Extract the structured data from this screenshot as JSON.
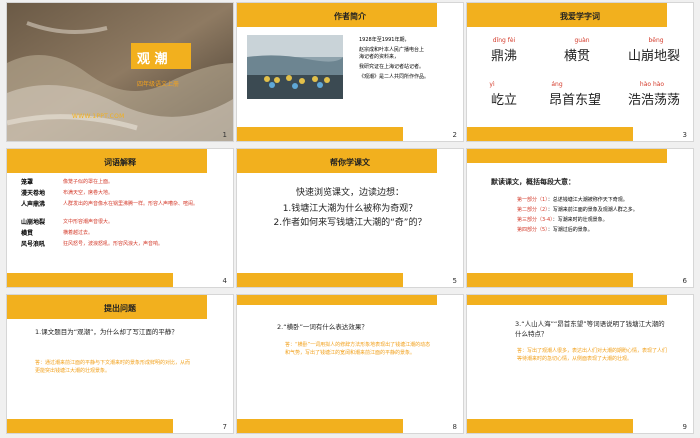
{
  "s1": {
    "title": "观 潮",
    "subtitle": "四年级语文上册",
    "website": "WWW.1PPT.COM",
    "num": "1"
  },
  "s2": {
    "title": "作者简介",
    "num": "2",
    "lines": [
      "1928年至1991年期，",
      "赵宗成和叶本人民广播电台上",
      "海记者的资料来，",
      "我研究证在上海记者站记者。",
      "《观潮》是二人共同所作作品。"
    ]
  },
  "s3": {
    "title": "我爱学字词",
    "num": "3",
    "words": [
      {
        "py": "dǐng  fèi",
        "ch": "鼎沸"
      },
      {
        "py": "guàn",
        "ch": "横贯"
      },
      {
        "py": "bēng",
        "ch": "山崩地裂"
      },
      {
        "py": "yì",
        "ch": "屹立"
      },
      {
        "py": "áng",
        "ch": "昂首东望"
      },
      {
        "py": "hào hào",
        "ch": "浩浩荡荡"
      }
    ]
  },
  "s4": {
    "title": "词语解释",
    "num": "4",
    "rows": [
      {
        "term": "笼罩",
        "def": "像笼子似的罩在上面。"
      },
      {
        "term": "漫天卷地",
        "def": "布满天空，席卷大地。"
      },
      {
        "term": "人声鼎沸",
        "def": "人群发出的声音像水在锅里沸腾一样。形容人声嘈杂、喧闹。"
      },
      {
        "term": "山崩地裂",
        "def": "文中形容潮声音很大。"
      },
      {
        "term": "横贯",
        "def": "横着越过去。"
      },
      {
        "term": "风号浪吼",
        "def": "狂风怒号，波浪怒吼。形容风浪大，声音响。"
      }
    ]
  },
  "s5": {
    "title": "帮你学课文",
    "num": "5",
    "intro": "快速浏览课文，边读边想：",
    "q1": "1.钱塘江大潮为什么被称为奇观？",
    "q2": "2.作者如何来写钱塘江大潮的“奇”的？"
  },
  "s6": {
    "title": "默读课文，概括每段大意：",
    "num": "6",
    "rows": [
      {
        "part": "第一部分（1）",
        "text": "：总述钱塘江大潮被称作天下奇观。"
      },
      {
        "part": "第二部分（2）",
        "text": "：写潮来前江面的景象及观潮人群之多。"
      },
      {
        "part": "第三部分（3-4）",
        "text": "：写潮来时的壮观景象。"
      },
      {
        "part": "第四部分（5）",
        "text": "：写潮过后的景象。"
      }
    ]
  },
  "s7": {
    "title": "提出问题",
    "num": "7",
    "q": "1.课文题目为“观潮”，为什么却了写江面的平静？",
    "a": "答：通过潮来前江面的平静与下文潮来时的景象形成鲜明的对比，从而更能突出钱塘江大潮的壮观景象。"
  },
  "s8": {
    "num": "8",
    "q": "2.“横卧”一词有什么表达效果？",
    "a": "答：“横卧”一词用拟人的修辞方法形象地表现出了钱塘江潮的动态和气势，写出了钱塘江的宽阔和潮来前江面的平静的景象。"
  },
  "s9": {
    "num": "9",
    "q": "3.“人山人海”“昂首东望”等词语说明了钱塘江大潮的什么特点？",
    "a": "答：写出了观潮人很多，表达出人们对大潮的期盼心情，表现了人们等待潮来时的急切心情，从侧面表现了大潮的壮观。"
  }
}
